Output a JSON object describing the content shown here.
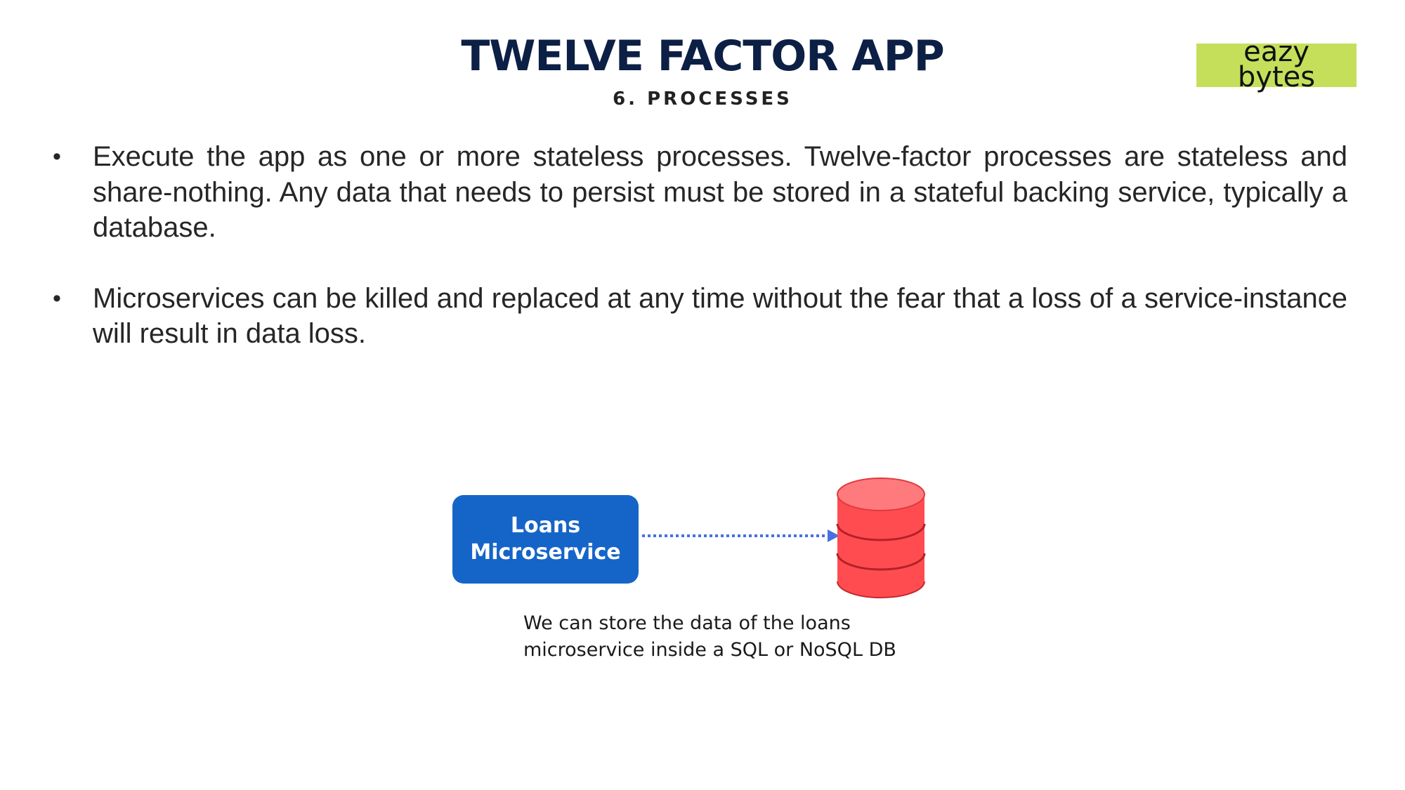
{
  "header": {
    "title": "TWELVE FACTOR APP",
    "subtitle": "6. PROCESSES"
  },
  "logo": {
    "line1": "eazy",
    "line2": "bytes",
    "background_color": "#c5df5b"
  },
  "bullets": [
    {
      "marker": "•",
      "text": "Execute the app as one or more stateless processes. Twelve-factor processes are stateless and share-nothing. Any data that needs to persist must be stored in a stateful backing service, typically a database."
    },
    {
      "marker": "•",
      "text": "Microservices can be killed and replaced at any time without the fear that a loss of a service-instance will result in data loss."
    }
  ],
  "diagram": {
    "service": {
      "line1": "Loans",
      "line2": "Microservice",
      "color": "#1565c8"
    },
    "connector": {
      "style": "dotted-arrow",
      "color": "#4a6fe0"
    },
    "database": {
      "icon": "database-cylinder-icon",
      "color": "#ff5457"
    },
    "caption": {
      "line1": "We can store the data of the loans",
      "line2": "microservice inside a SQL or NoSQL DB"
    }
  },
  "colors": {
    "title": "#0c1f45",
    "body_text": "#262626"
  }
}
